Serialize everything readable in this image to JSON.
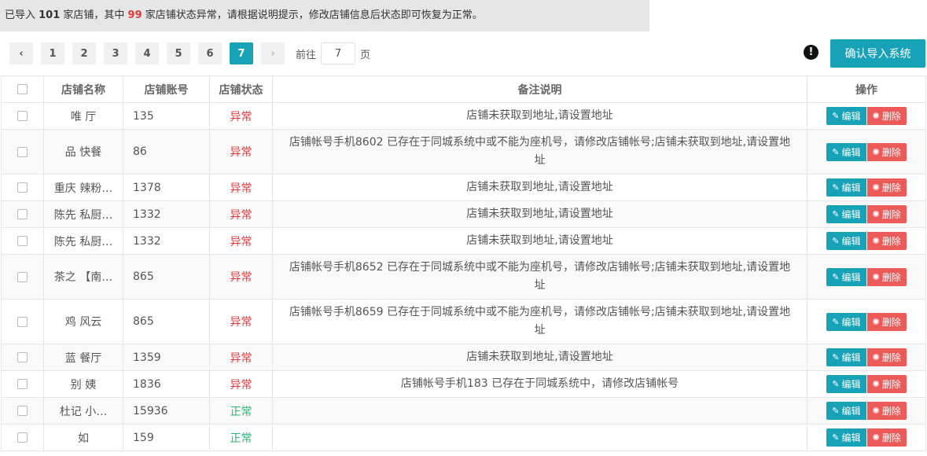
{
  "banner": {
    "prefix": "已导入 ",
    "total": "101",
    "mid1": " 家店铺，其中 ",
    "abnormal": "99",
    "suffix": " 家店铺状态异常，请根据说明提示，修改店铺信息后状态即可恢复为正常。"
  },
  "pagination": {
    "prev": "‹",
    "pages": [
      "1",
      "2",
      "3",
      "4",
      "5",
      "6",
      "7"
    ],
    "active_page": "7",
    "next": "›",
    "goto_label": "前往",
    "goto_value": "7",
    "goto_unit": "页"
  },
  "actions": {
    "warn_icon": "!",
    "confirm_label": "确认导入系统"
  },
  "table": {
    "headers": [
      "店铺名称",
      "店铺账号",
      "店铺状态",
      "备注说明",
      "操作"
    ],
    "edit_label": "编辑",
    "delete_label": "删除",
    "rows": [
      {
        "name": "唯 厅",
        "account": "135",
        "status": "异常",
        "note": "店铺未获取到地址,请设置地址",
        "ok": false
      },
      {
        "name": "品 快餐",
        "account": "86",
        "status": "异常",
        "note": "店铺帐号手机8602 已存在于同城系统中或不能为座机号，请修改店铺帐号;店铺未获取到地址,请设置地址",
        "ok": false
      },
      {
        "name": "重庆 辣粉…",
        "account": "1378",
        "status": "异常",
        "note": "店铺未获取到地址,请设置地址",
        "ok": false
      },
      {
        "name": "陈先 私厨…",
        "account": "1332",
        "status": "异常",
        "note": "店铺未获取到地址,请设置地址",
        "ok": false
      },
      {
        "name": "陈先 私厨…",
        "account": "1332",
        "status": "异常",
        "note": "店铺未获取到地址,请设置地址",
        "ok": false
      },
      {
        "name": "茶之 【南…",
        "account": "865",
        "status": "异常",
        "note": "店铺帐号手机8652 已存在于同城系统中或不能为座机号，请修改店铺帐号;店铺未获取到地址,请设置地址",
        "ok": false
      },
      {
        "name": "鸡 风云",
        "account": "865",
        "status": "异常",
        "note": "店铺帐号手机8659 已存在于同城系统中或不能为座机号，请修改店铺帐号;店铺未获取到地址,请设置地址",
        "ok": false
      },
      {
        "name": "蓝 餐厅",
        "account": "1359",
        "status": "异常",
        "note": "店铺未获取到地址,请设置地址",
        "ok": false
      },
      {
        "name": "别 姨",
        "account": "1836",
        "status": "异常",
        "note": "店铺帐号手机183 已存在于同城系统中，请修改店铺帐号",
        "ok": false
      },
      {
        "name": "杜记 小…",
        "account": "15936",
        "status": "正常",
        "note": "",
        "ok": true
      },
      {
        "name": "如",
        "account": "159",
        "status": "正常",
        "note": "",
        "ok": true
      }
    ]
  },
  "colors": {
    "accent": "#17a2b8",
    "danger": "#ec5a5a",
    "abnormal_text": "#e4393c",
    "normal_text": "#2bb673"
  }
}
